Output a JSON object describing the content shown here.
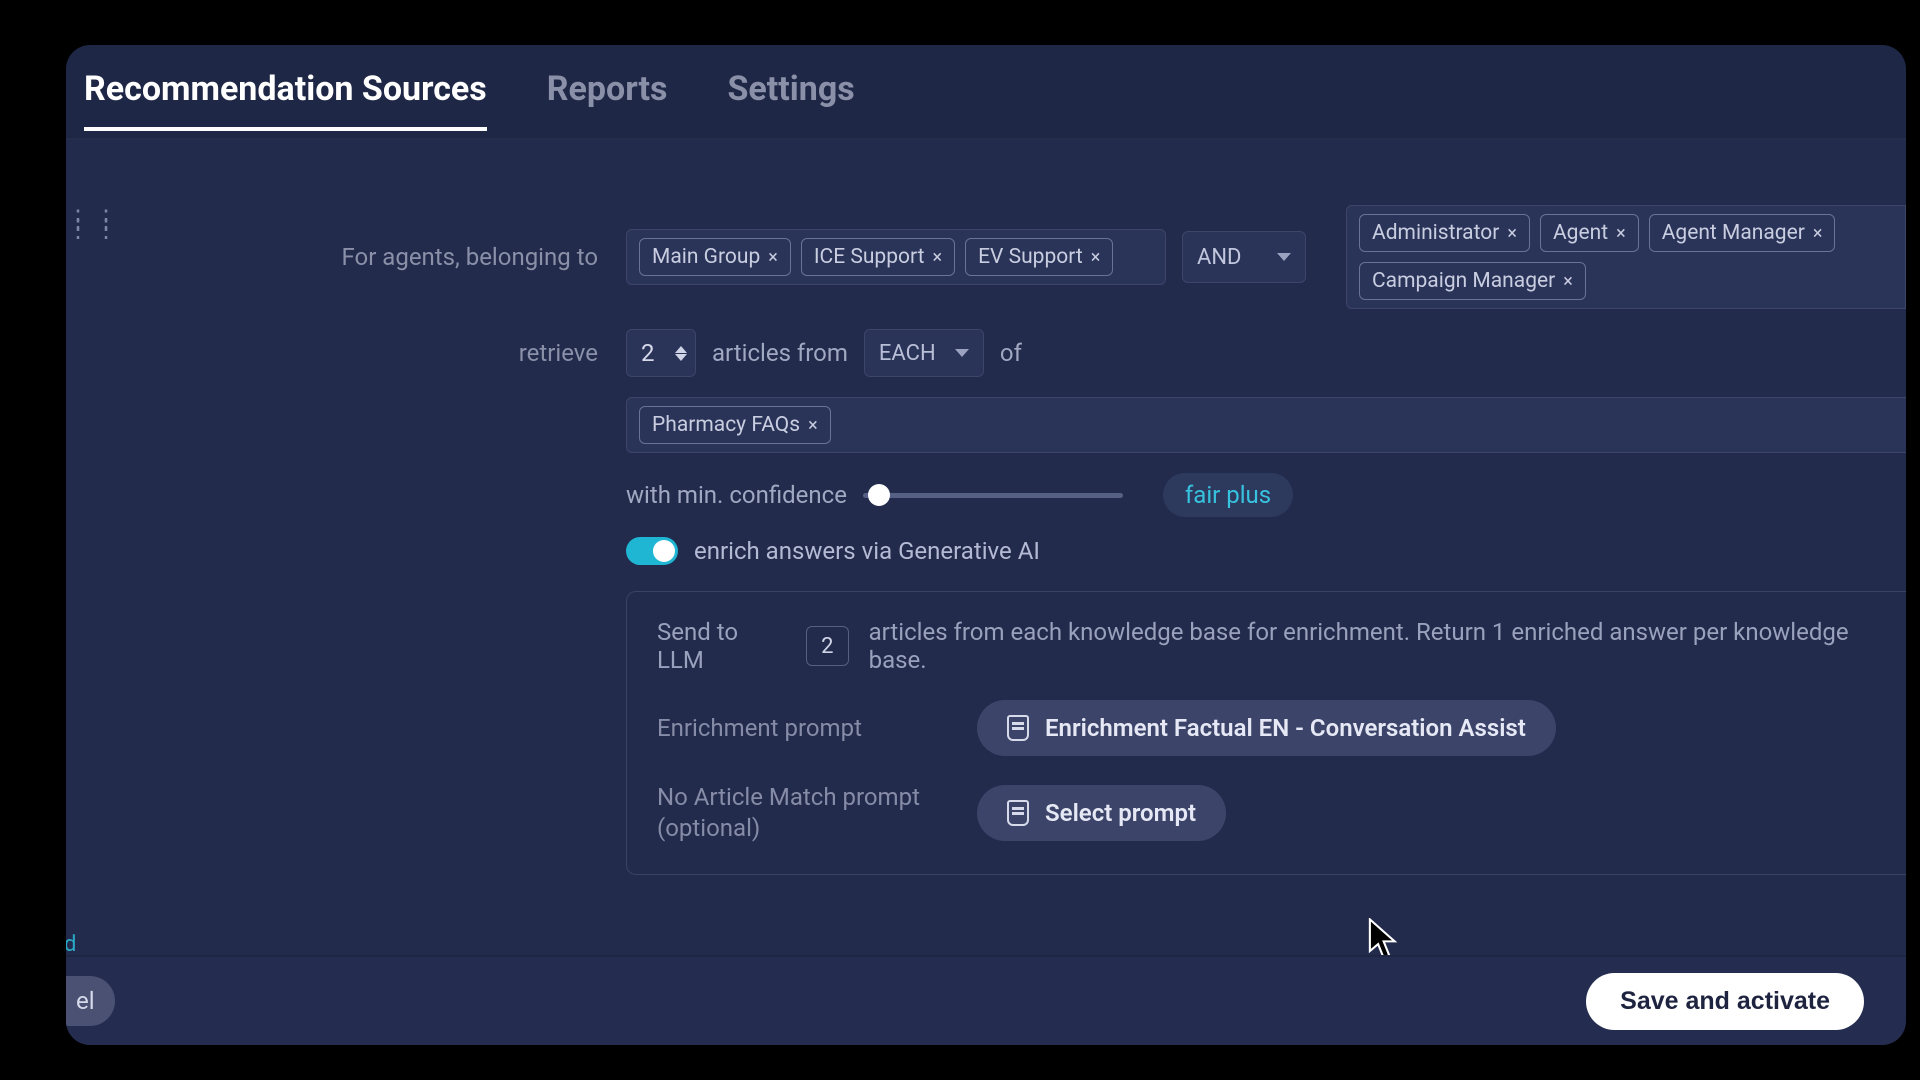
{
  "tabs": {
    "recommendation_sources": "Recommendation Sources",
    "reports": "Reports",
    "settings": "Settings"
  },
  "form": {
    "agents_label": "For agents, belonging to",
    "agent_groups": [
      "Main Group",
      "ICE Support",
      "EV Support"
    ],
    "operator_options": [
      "AND"
    ],
    "operator_selected": "AND",
    "roles": [
      "Administrator",
      "Agent",
      "Agent Manager",
      "Campaign Manager"
    ],
    "retrieve_label": "retrieve",
    "retrieve_count": "2",
    "articles_from": "articles from",
    "each_options": [
      "EACH"
    ],
    "each_selected": "EACH",
    "of_text": "of",
    "knowledge_bases": [
      "Pharmacy FAQs"
    ],
    "confidence_label": "with min. confidence",
    "confidence_level": "fair plus",
    "enrich_toggle_on": true,
    "enrich_label": "enrich answers via Generative AI"
  },
  "panel": {
    "send_prefix": "Send to LLM",
    "send_count": "2",
    "send_suffix": "articles from each knowledge base for enrichment. Return 1 enriched answer per knowledge base.",
    "enrichment_prompt_label": "Enrichment prompt",
    "enrichment_prompt_value": "Enrichment Factual EN - Conversation Assist",
    "no_match_label": "No Article Match prompt (optional)",
    "no_match_value": "Select prompt"
  },
  "footer": {
    "cancel_fragment": "el",
    "save": "Save and activate"
  },
  "edge_link_fragment": "d"
}
